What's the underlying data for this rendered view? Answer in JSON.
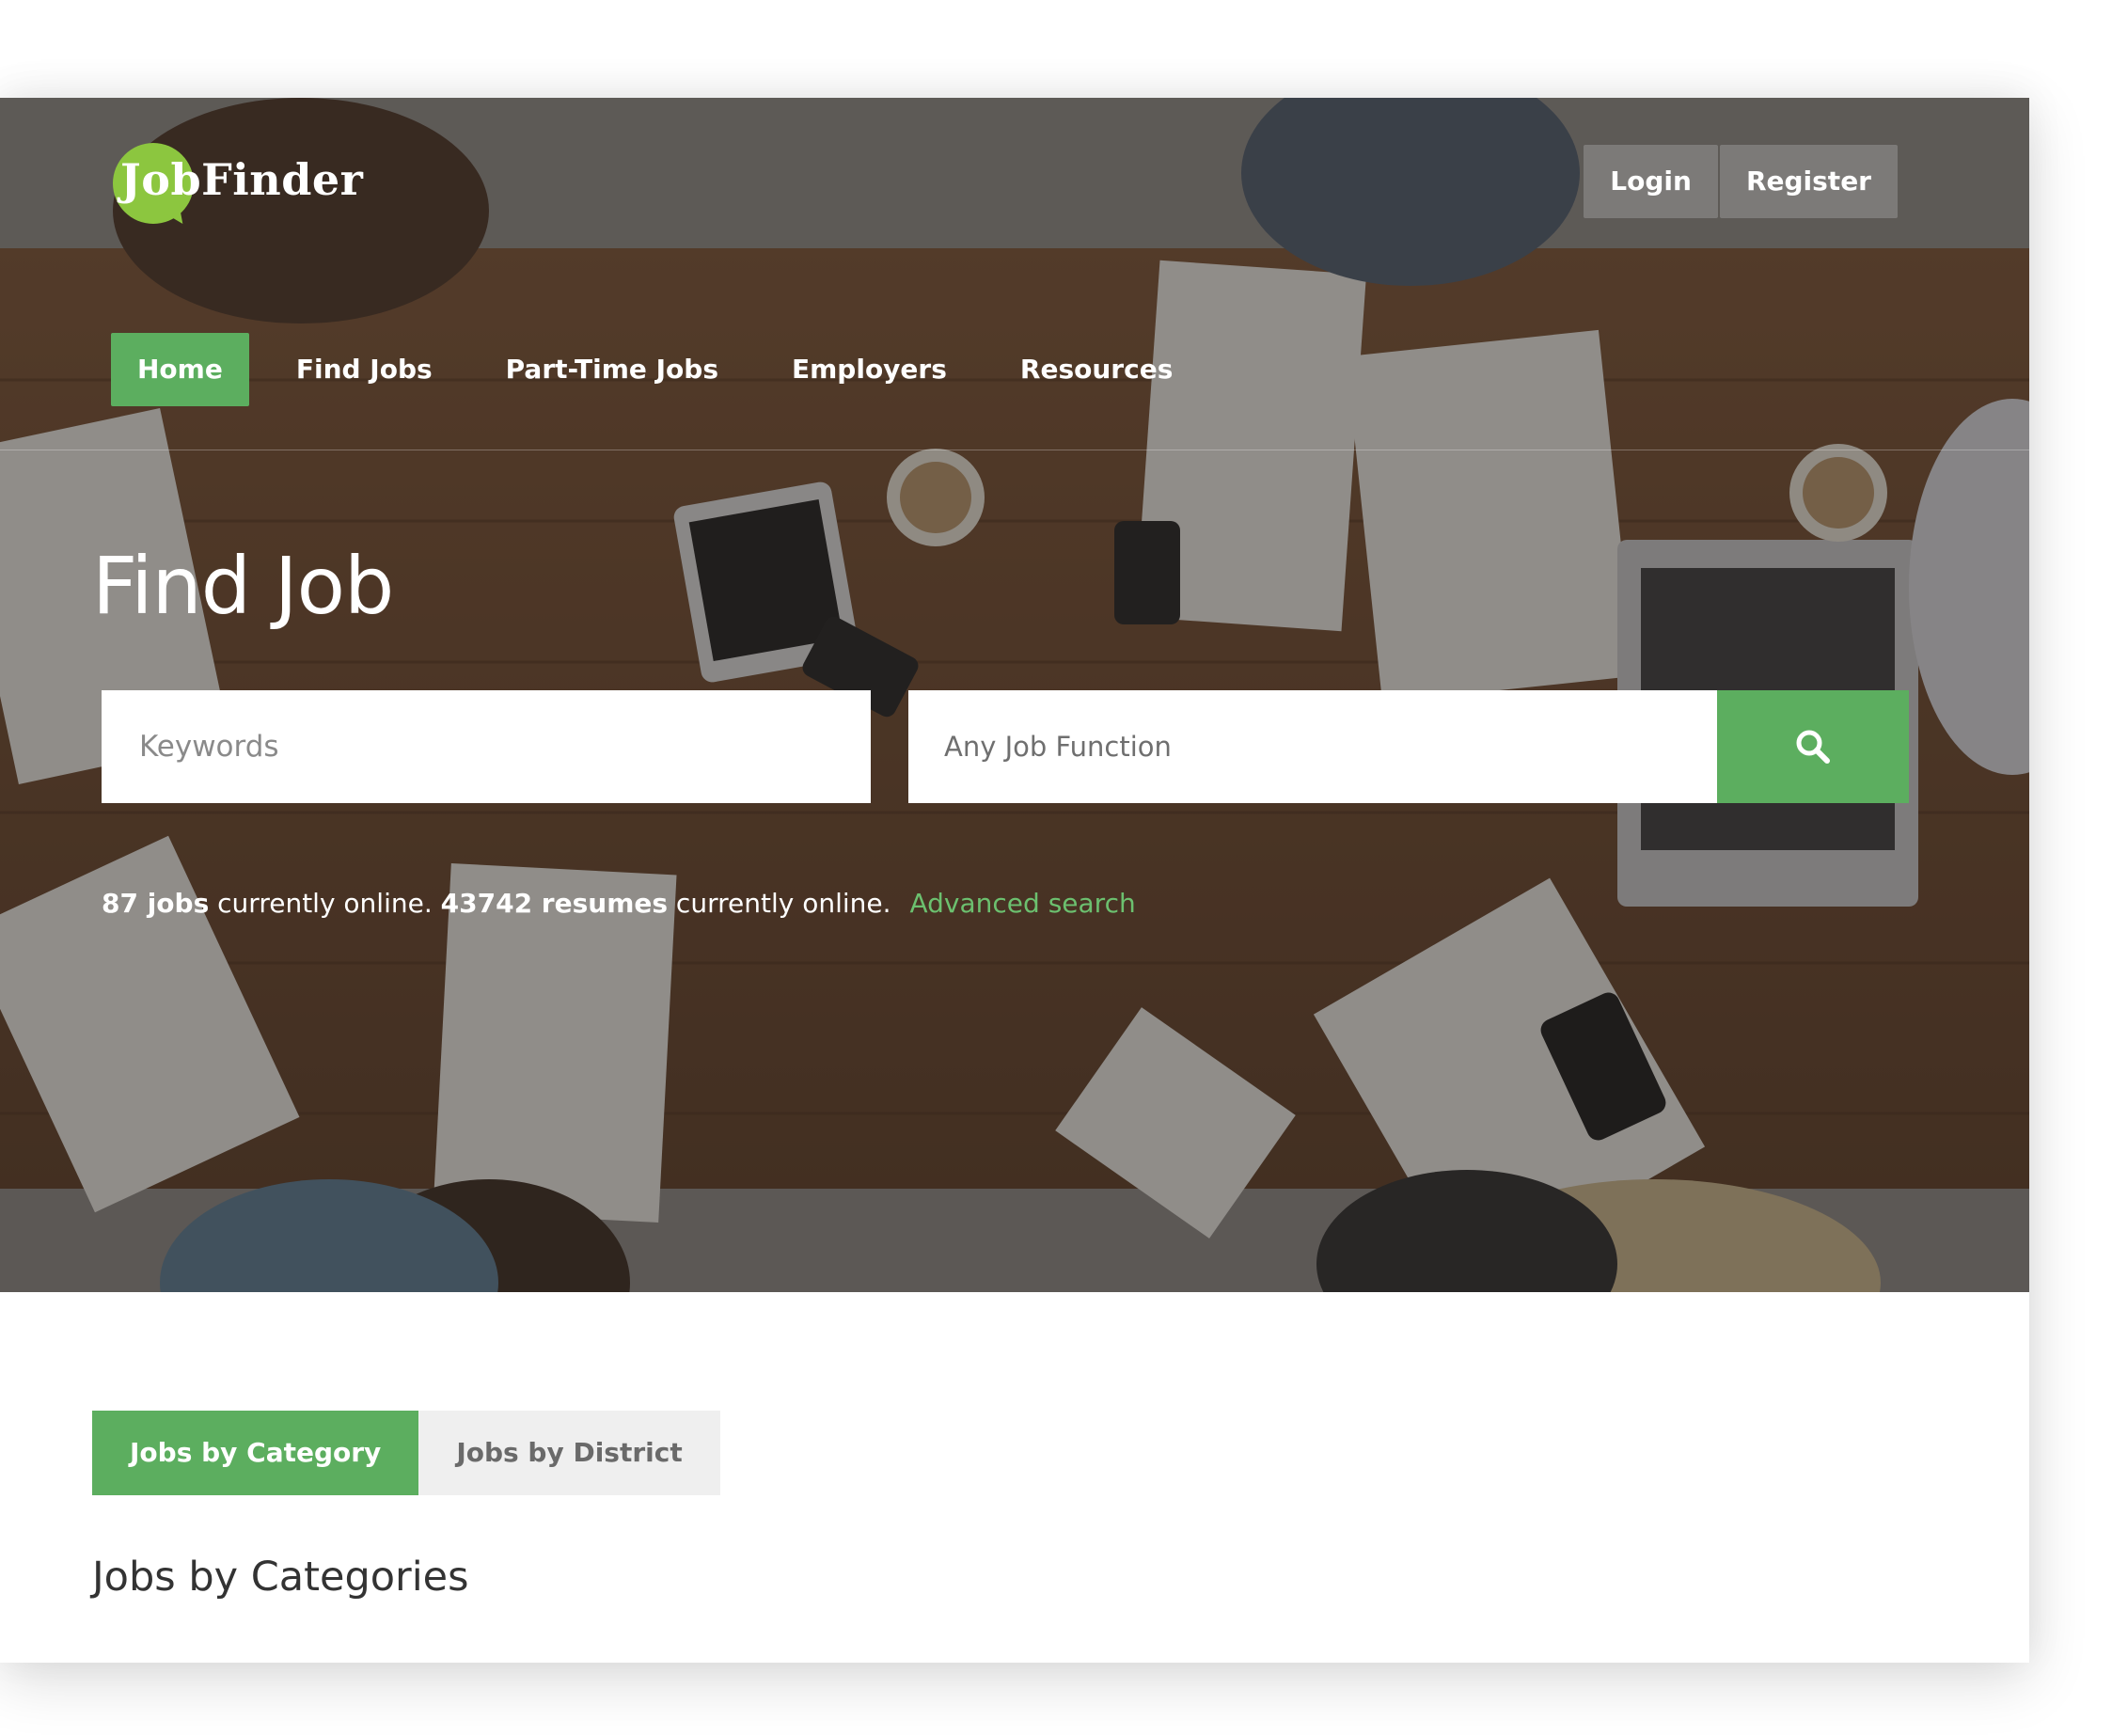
{
  "brand": {
    "logo_text": "JobFinder",
    "accent": "#5cae5f",
    "logo_green": "#8cc63f",
    "link_green": "#6cc06f"
  },
  "auth": {
    "login_label": "Login",
    "register_label": "Register"
  },
  "nav": {
    "items": [
      {
        "label": "Home",
        "active": true
      },
      {
        "label": "Find Jobs",
        "active": false
      },
      {
        "label": "Part-Time Jobs",
        "active": false
      },
      {
        "label": "Employers",
        "active": false
      },
      {
        "label": "Resources",
        "active": false
      }
    ]
  },
  "hero": {
    "title": "Find Job",
    "keywords_placeholder": "Keywords",
    "job_function_value": "Any Job Function",
    "search_icon": "search-icon"
  },
  "stats": {
    "jobs_count": "87 jobs",
    "jobs_suffix": " currently online. ",
    "resumes_count": "43742 resumes",
    "resumes_suffix": " currently online.",
    "advanced_search": "Advanced search"
  },
  "tabs": [
    {
      "label": "Jobs by Category",
      "active": true
    },
    {
      "label": "Jobs by District",
      "active": false
    }
  ],
  "section": {
    "title": "Jobs by Categories"
  }
}
